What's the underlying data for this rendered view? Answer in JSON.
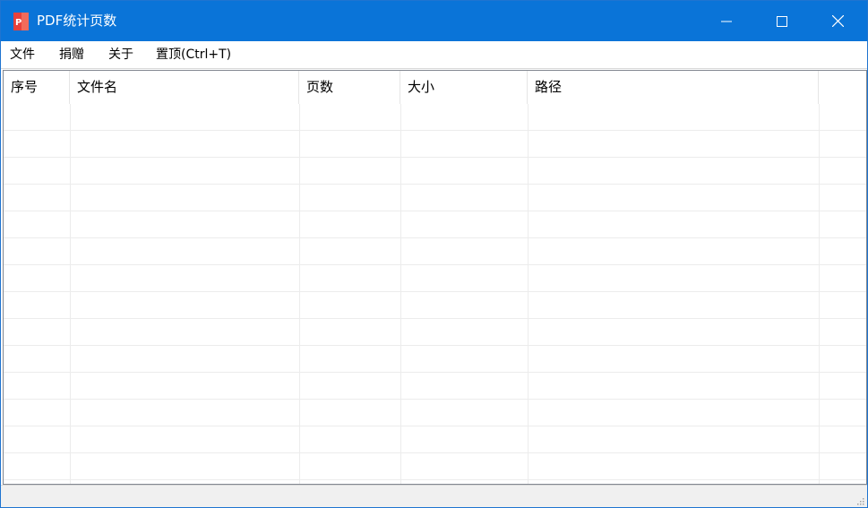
{
  "window": {
    "title": "PDF统计页数",
    "accent_color": "#0a74d8",
    "app_icon": "pdf-icon"
  },
  "window_controls": {
    "minimize_icon": "minimize-icon",
    "maximize_icon": "maximize-icon",
    "close_icon": "close-icon"
  },
  "menu": {
    "items": [
      {
        "label": "文件"
      },
      {
        "label": "捐赠"
      },
      {
        "label": "关于"
      },
      {
        "label": "置顶(Ctrl+T)"
      }
    ]
  },
  "table": {
    "columns": [
      {
        "label": "序号"
      },
      {
        "label": "文件名"
      },
      {
        "label": "页数"
      },
      {
        "label": "大小"
      },
      {
        "label": "路径"
      }
    ],
    "rows": []
  },
  "statusbar": {
    "text": ""
  }
}
